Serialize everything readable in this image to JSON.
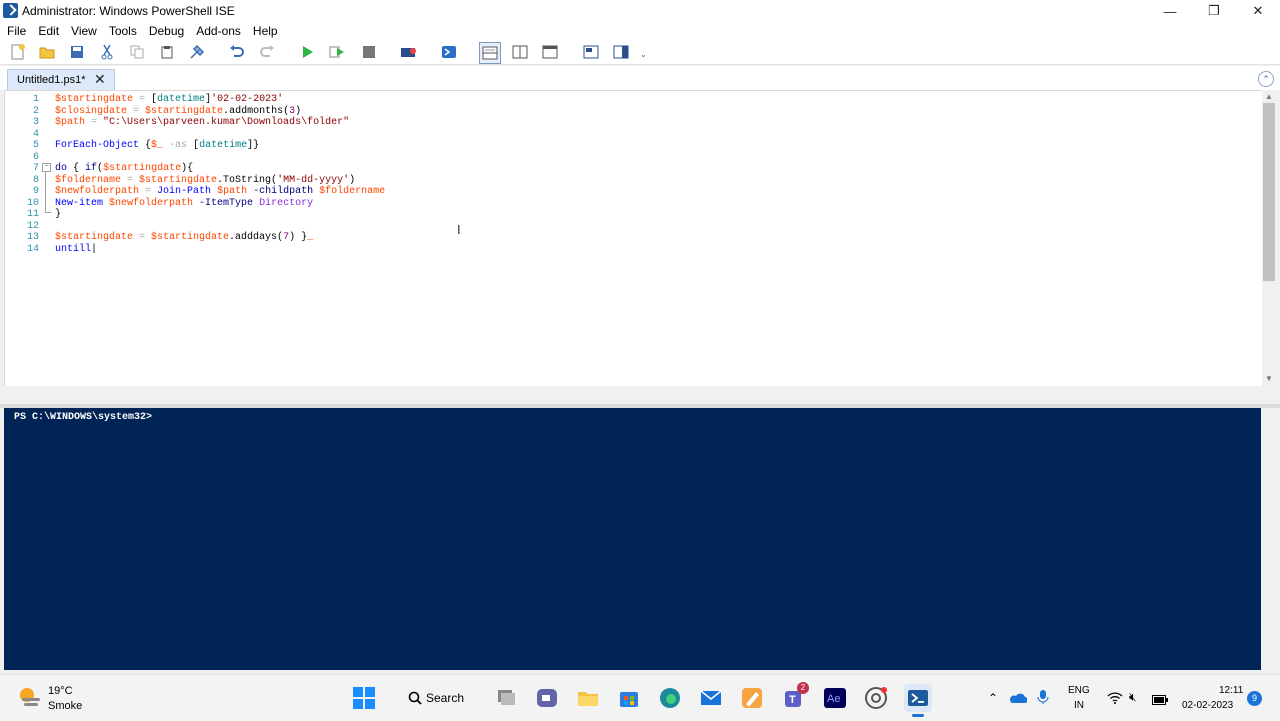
{
  "window": {
    "title": "Administrator: Windows PowerShell ISE",
    "min": "—",
    "restore": "❐",
    "close": "✕"
  },
  "menu": [
    "File",
    "Edit",
    "View",
    "Tools",
    "Debug",
    "Add-ons",
    "Help"
  ],
  "toolbar": {
    "icons": [
      "new-file-icon",
      "open-folder-icon",
      "save-icon",
      "cut-icon",
      "copy-icon",
      "paste-icon",
      "clear-console-icon",
      "undo-icon",
      "redo-icon",
      "run-script-icon",
      "run-selection-icon",
      "stop-icon",
      "new-remote-tab-icon",
      "start-powershell-icon",
      "show-script-pane-top-icon",
      "show-script-pane-right-icon",
      "show-script-pane-maximized-icon",
      "show-command-window-icon",
      "show-command-addon-icon"
    ]
  },
  "tab": {
    "label": "Untitled1.ps1*",
    "close": "✕"
  },
  "editor": {
    "line_numbers": [
      "1",
      "2",
      "3",
      "4",
      "5",
      "6",
      "7",
      "8",
      "9",
      "10",
      "11",
      "12",
      "13",
      "14"
    ]
  },
  "console": {
    "prompt": "PS C:\\WINDOWS\\system32>"
  },
  "taskbar": {
    "weather_temp": "19°C",
    "weather_desc": "Smoke",
    "search_label": "Search",
    "teams_badge": "2",
    "lang_top": "ENG",
    "lang_bottom": "IN",
    "time": "12:11",
    "date": "02-02-2023",
    "notif_count": "9"
  },
  "colors": {
    "console_bg": "#012456",
    "line_number": "#2b91af",
    "variable": "#ff4500",
    "string": "#8b0000",
    "command": "#0000ff"
  }
}
